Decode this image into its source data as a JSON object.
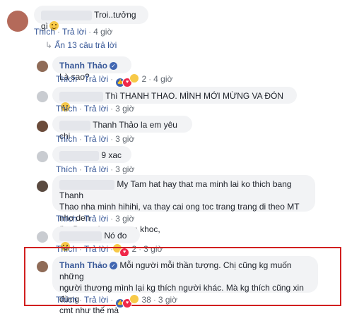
{
  "top_comment": {
    "text": "Troi..tưởng gì",
    "emoji": "smirk-emoji",
    "actions": {
      "like": "Thích",
      "reply": "Trả lời",
      "time": "4 giờ"
    }
  },
  "hidden_replies_label": "Ẩn 13 câu trả lời",
  "replies": [
    {
      "name": "Thanh Thảo",
      "verified": true,
      "text": "Là sao?",
      "actions": {
        "like": "Thích",
        "reply": "Trả lời",
        "count": "2",
        "time": "4 giờ"
      }
    },
    {
      "name": "",
      "text": "Thì THANH THAO. MÌNH MỚI MỪNG VA ĐÓN",
      "actions": {
        "like": "Thích",
        "reply": "Trả lời",
        "time": "3 giờ"
      }
    },
    {
      "name": "",
      "text": "Thanh Thảo la em yêu chị",
      "actions": {
        "like": "Thích",
        "reply": "Trả lời",
        "time": "3 giờ"
      }
    },
    {
      "name": "",
      "text": "9 xac",
      "actions": {
        "like": "Thích",
        "reply": "Trả lời",
        "time": "3 giờ"
      }
    },
    {
      "name": "",
      "text_lines": [
        "My Tam hat hay that ma minh lai ko thich bang Thanh",
        "Thao nha minh hihihi, va thay cai ong toc trang trang di theo MT nho den",
        "fim Bong dung muon khoc,"
      ],
      "actions": {
        "like": "Thích",
        "reply": "Trả lời",
        "time": "3 giờ"
      }
    },
    {
      "name": "",
      "text": "Nó đo",
      "actions": {
        "like": "Thích",
        "reply": "Trả lời",
        "count": "2",
        "time": "3 giờ"
      }
    },
    {
      "name": "Thanh Thảo",
      "verified": true,
      "text_lines": [
        "Mỗi người mỗi thần tượng. Chị cũng kg muốn những",
        "người thương mình lại kg thích người khác. Mà kg thích cũng xin đừng",
        "cmt như thế mà"
      ],
      "actions": {
        "like": "Thích",
        "reply": "Trả lời",
        "count": "38",
        "time": "3 giờ"
      }
    }
  ],
  "colors": {
    "link": "#385898",
    "bubble": "#f2f3f5",
    "highlight": "#d11f1f"
  }
}
